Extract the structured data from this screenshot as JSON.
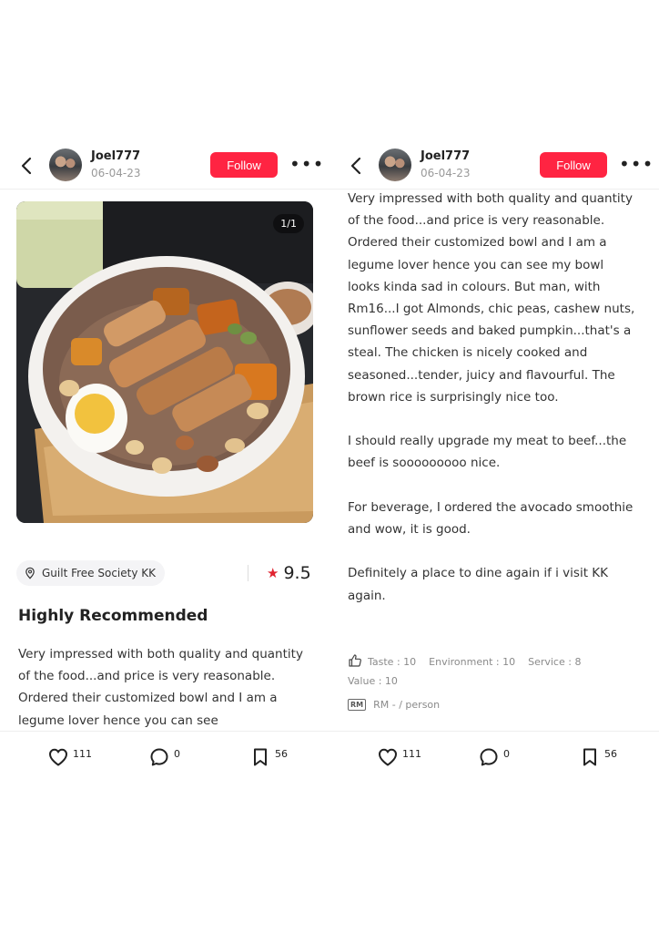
{
  "left": {
    "header": {
      "username": "Joel777",
      "date": "06-04-23",
      "follow_label": "Follow",
      "more_label": "•••"
    },
    "image": {
      "counter": "1/1"
    },
    "location": "Guilt Free Society KK",
    "rating": "9.5",
    "title": "Highly Recommended",
    "body": "Very impressed with both quality and quantity of the food...and price is very reasonable. Ordered their customized bowl and I am a legume lover hence you can see",
    "actions": {
      "likes": "111",
      "comments": "0",
      "saves": "56"
    }
  },
  "right": {
    "header": {
      "username": "Joel777",
      "date": "06-04-23",
      "follow_label": "Follow",
      "more_label": "•••"
    },
    "body": "Very impressed with both quality and quantity of the food...and price is very reasonable. Ordered their customized bowl and I am a legume lover hence you can see my bowl looks kinda sad in colours. But man, with Rm16...I got Almonds, chic peas, cashew nuts, sunflower seeds and baked pumpkin...that's a steal. The chicken is nicely cooked and seasoned...tender, juicy and flavourful. The brown rice is surprisingly nice too.\n\nI should really upgrade my meat to beef...the beef is sooooooooo nice.\n\nFor beverage, I ordered the avocado smoothie and wow, it is good.\n\nDefinitely a place to dine again if i visit KK again.",
    "scores": {
      "taste": "Taste : 10",
      "environment": "Environment : 10",
      "service": "Service : 8",
      "value": "Value : 10"
    },
    "price": {
      "badge": "RM",
      "text": "RM - / person"
    },
    "actions": {
      "likes": "111",
      "comments": "0",
      "saves": "56"
    }
  },
  "colors": {
    "accent": "#ff2442",
    "star": "#e0232f"
  },
  "icons": [
    "back-arrow-icon",
    "location-pin-icon",
    "star-icon",
    "thumbs-up-icon",
    "heart-icon",
    "comment-icon",
    "bookmark-icon",
    "more-icon"
  ]
}
